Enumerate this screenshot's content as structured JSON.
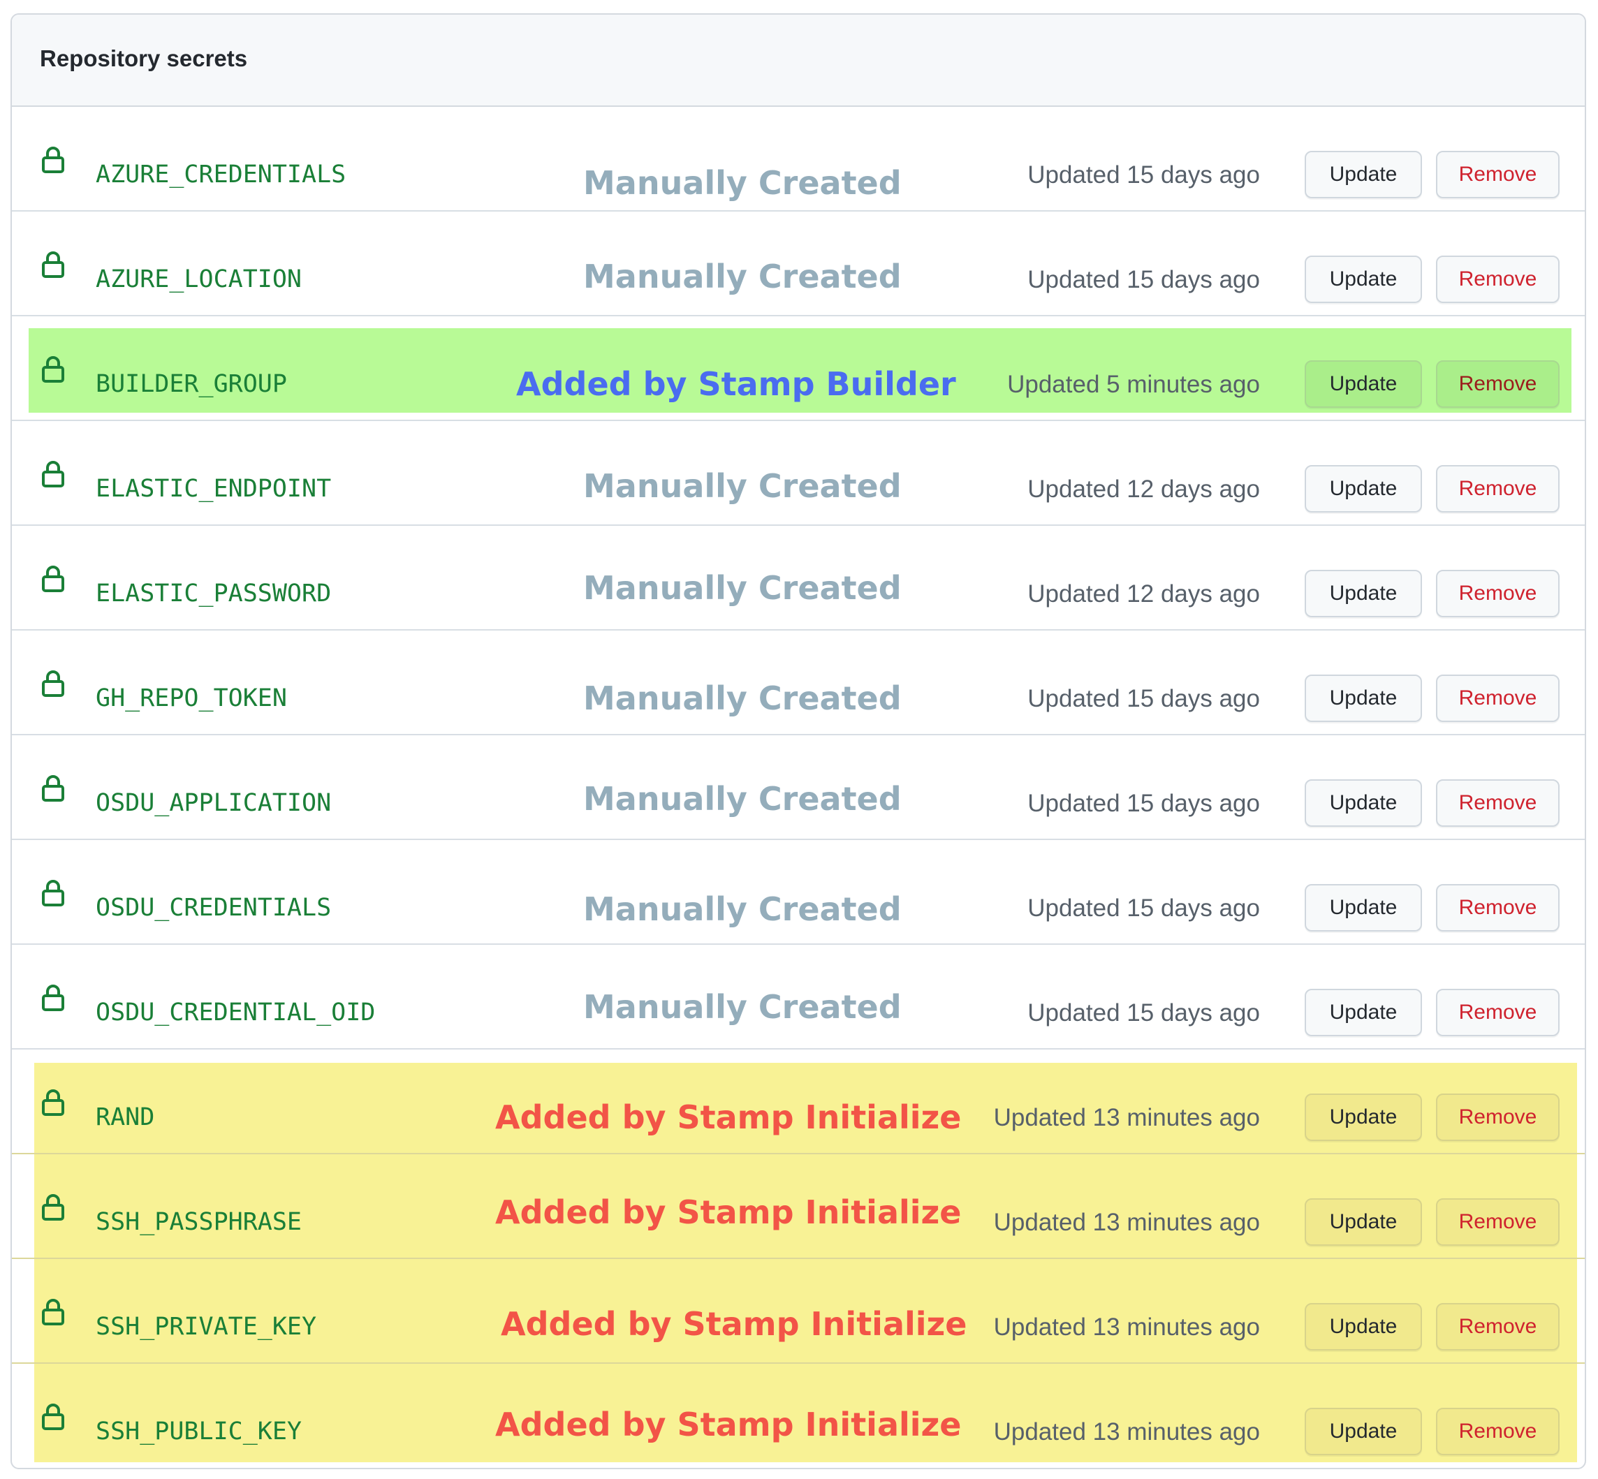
{
  "section": {
    "title": "Repository secrets"
  },
  "colors": {
    "secret_name": "#1a7f37",
    "manual_annotation": "#94adbb",
    "builder_annotation": "#4a6cf0",
    "initialize_annotation": "#f25447",
    "builder_highlight": "#b8fa96",
    "initialize_highlight": "#f8f295",
    "remove_text": "#cf222e"
  },
  "icons": {
    "row_icon": "lock-icon"
  },
  "secrets": [
    {
      "name": "AZURE_CREDENTIALS",
      "annotation": "Manually Created",
      "updated": "Updated 15 days ago",
      "update_label": "Update",
      "remove_label": "Remove"
    },
    {
      "name": "AZURE_LOCATION",
      "annotation": "Manually Created",
      "updated": "Updated 15 days ago",
      "update_label": "Update",
      "remove_label": "Remove"
    },
    {
      "name": "BUILDER_GROUP",
      "annotation": "Added by Stamp Builder",
      "updated": "Updated 5 minutes ago",
      "update_label": "Update",
      "remove_label": "Remove"
    },
    {
      "name": "ELASTIC_ENDPOINT",
      "annotation": "Manually Created",
      "updated": "Updated 12 days ago",
      "update_label": "Update",
      "remove_label": "Remove"
    },
    {
      "name": "ELASTIC_PASSWORD",
      "annotation": "Manually Created",
      "updated": "Updated 12 days ago",
      "update_label": "Update",
      "remove_label": "Remove"
    },
    {
      "name": "GH_REPO_TOKEN",
      "annotation": "Manually Created",
      "updated": "Updated 15 days ago",
      "update_label": "Update",
      "remove_label": "Remove"
    },
    {
      "name": "OSDU_APPLICATION",
      "annotation": "Manually Created",
      "updated": "Updated 15 days ago",
      "update_label": "Update",
      "remove_label": "Remove"
    },
    {
      "name": "OSDU_CREDENTIALS",
      "annotation": "Manually Created",
      "updated": "Updated 15 days ago",
      "update_label": "Update",
      "remove_label": "Remove"
    },
    {
      "name": "OSDU_CREDENTIAL_OID",
      "annotation": "Manually Created",
      "updated": "Updated 15 days ago",
      "update_label": "Update",
      "remove_label": "Remove"
    },
    {
      "name": "RAND",
      "annotation": "Added by Stamp Initialize",
      "updated": "Updated 13 minutes ago",
      "update_label": "Update",
      "remove_label": "Remove"
    },
    {
      "name": "SSH_PASSPHRASE",
      "annotation": "Added by Stamp Initialize",
      "updated": "Updated 13 minutes ago",
      "update_label": "Update",
      "remove_label": "Remove"
    },
    {
      "name": "SSH_PRIVATE_KEY",
      "annotation": "Added by Stamp Initialize",
      "updated": "Updated 13 minutes ago",
      "update_label": "Update",
      "remove_label": "Remove"
    },
    {
      "name": "SSH_PUBLIC_KEY",
      "annotation": "Added by Stamp Initialize",
      "updated": "Updated 13 minutes ago",
      "update_label": "Update",
      "remove_label": "Remove"
    }
  ]
}
